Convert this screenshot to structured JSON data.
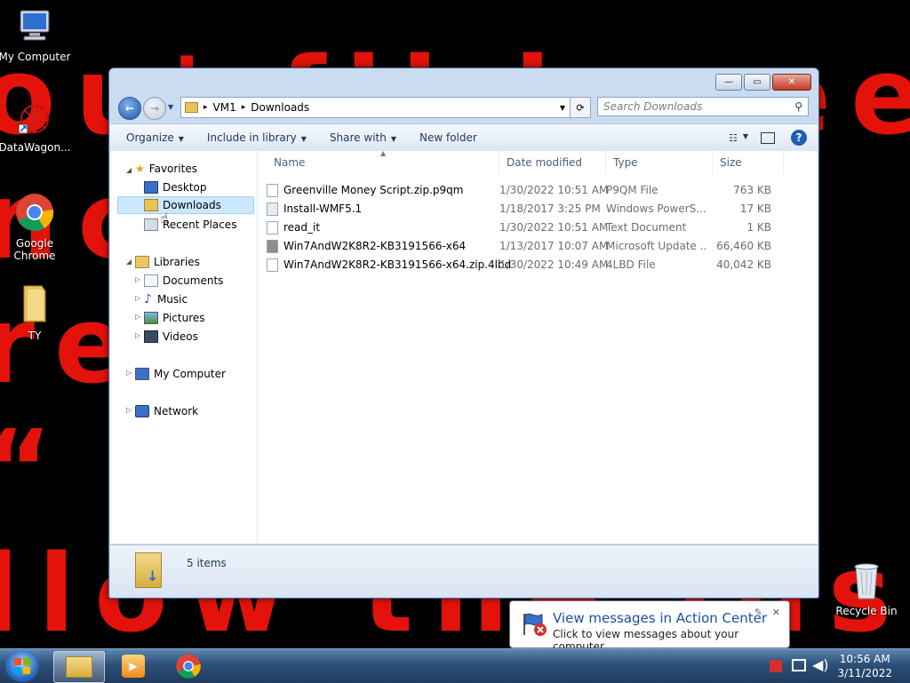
{
  "wallpaper": {
    "lines": [
      "ou'  fil   be   ee",
      "nc          r  t",
      "re   ac       en",
      "  “          d",
      "llow the instr   ioi"
    ]
  },
  "desktop": {
    "icons": [
      {
        "label": "My Computer"
      },
      {
        "label": "DataWagon..."
      },
      {
        "label": "Google Chrome"
      },
      {
        "label": "TY"
      },
      {
        "label": "Recycle Bin"
      }
    ]
  },
  "window": {
    "caption_buttons": {
      "minimize": "—",
      "maximize": "▭",
      "close": "✕"
    },
    "address": {
      "segments": [
        "VM1",
        "Downloads"
      ],
      "separator": "▸"
    },
    "search": {
      "placeholder": "Search Downloads"
    },
    "toolbar": {
      "organize": "Organize",
      "include_in_library": "Include in library",
      "share_with": "Share with",
      "new_folder": "New folder"
    },
    "nav": {
      "favorites": "Favorites",
      "desktop": "Desktop",
      "downloads": "Downloads",
      "recent_places": "Recent Places",
      "libraries": "Libraries",
      "documents": "Documents",
      "music": "Music",
      "pictures": "Pictures",
      "videos": "Videos",
      "my_computer": "My Computer",
      "network": "Network"
    },
    "columns": {
      "name": "Name",
      "date": "Date modified",
      "type": "Type",
      "size": "Size"
    },
    "files": [
      {
        "name": "Greenville Money Script.zip.p9qm",
        "date": "1/30/2022 10:51 AM",
        "type": "P9QM File",
        "size": "763 KB"
      },
      {
        "name": "Install-WMF5.1",
        "date": "1/18/2017 3:25 PM",
        "type": "Windows PowerS...",
        "size": "17 KB"
      },
      {
        "name": "read_it",
        "date": "1/30/2022 10:51 AM",
        "type": "Text Document",
        "size": "1 KB"
      },
      {
        "name": "Win7AndW2K8R2-KB3191566-x64",
        "date": "1/13/2017 10:07 AM",
        "type": "Microsoft Update ...",
        "size": "66,460 KB"
      },
      {
        "name": "Win7AndW2K8R2-KB3191566-x64.zip.4lbd",
        "date": "1/30/2022 10:49 AM",
        "type": "4LBD File",
        "size": "40,042 KB"
      }
    ],
    "status": {
      "item_count": "5 items"
    }
  },
  "notification": {
    "title": "View messages in Action Center",
    "body": "Click to view messages about your computer.",
    "close": "✕"
  },
  "taskbar": {
    "clock_time": "10:56 AM",
    "clock_date": "3/11/2022"
  },
  "colors": {
    "wallpaper_text": "#e3120b",
    "selection": "#cce8ff",
    "taskbar": "#2c4f78"
  }
}
